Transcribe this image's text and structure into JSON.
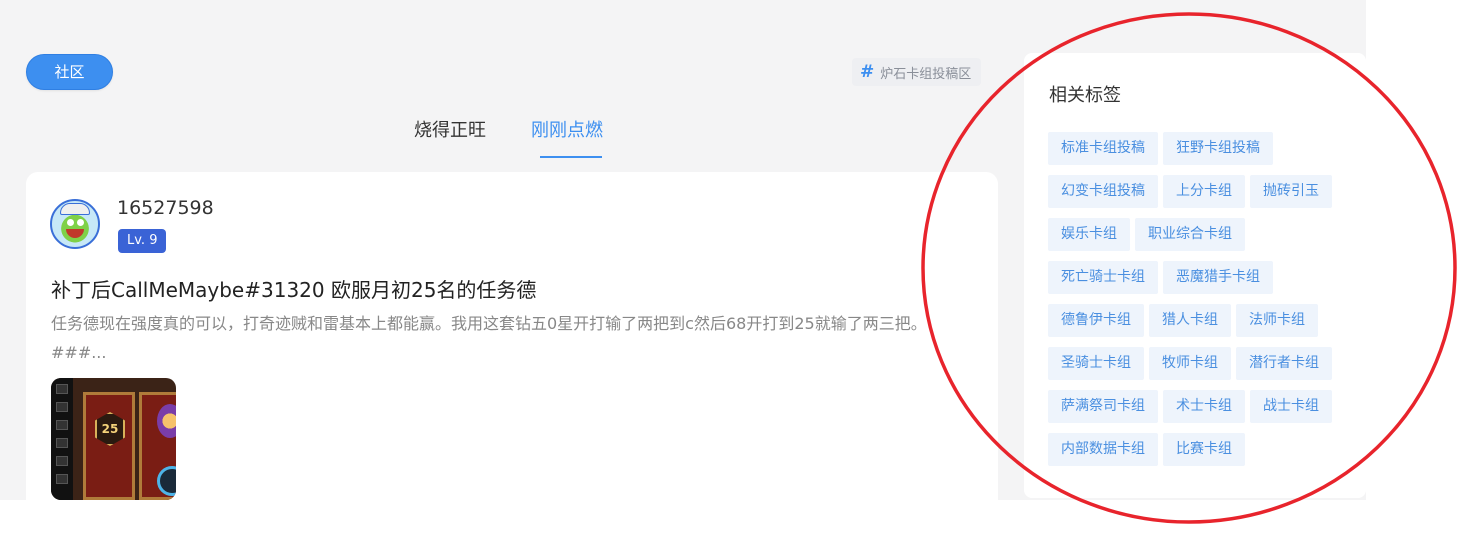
{
  "header": {
    "community_button": "社区",
    "topic_tag": {
      "hash": "#",
      "label": "炉石卡组投稿区"
    }
  },
  "tabs": [
    {
      "label": "烧得正旺",
      "active": false
    },
    {
      "label": "刚刚点燃",
      "active": true
    }
  ],
  "post": {
    "username": "16527598",
    "level": "Lv. 9",
    "title": "补丁后CallMeMaybe#31320 欧服月初25名的任务德",
    "excerpt": "任务德现在强度真的可以，打奇迹贼和雷基本上都能赢。我用这套钻五0星开打输了两把到c然后68开打到25就输了两三把。###...",
    "image_badge": "25"
  },
  "related_tags": {
    "title": "相关标签",
    "items": [
      "标准卡组投稿",
      "狂野卡组投稿",
      "幻变卡组投稿",
      "上分卡组",
      "抛砖引玉",
      "娱乐卡组",
      "职业综合卡组",
      "死亡骑士卡组",
      "恶魔猎手卡组",
      "德鲁伊卡组",
      "猎人卡组",
      "法师卡组",
      "圣骑士卡组",
      "牧师卡组",
      "潜行者卡组",
      "萨满祭司卡组",
      "术士卡组",
      "战士卡组",
      "内部数据卡组",
      "比赛卡组"
    ]
  },
  "colors": {
    "accent": "#3d8ff0",
    "level_badge": "#3a63d6",
    "tag_bg": "#eef4fc",
    "tag_text": "#4a8fe0",
    "annotation": "#e8242c"
  }
}
